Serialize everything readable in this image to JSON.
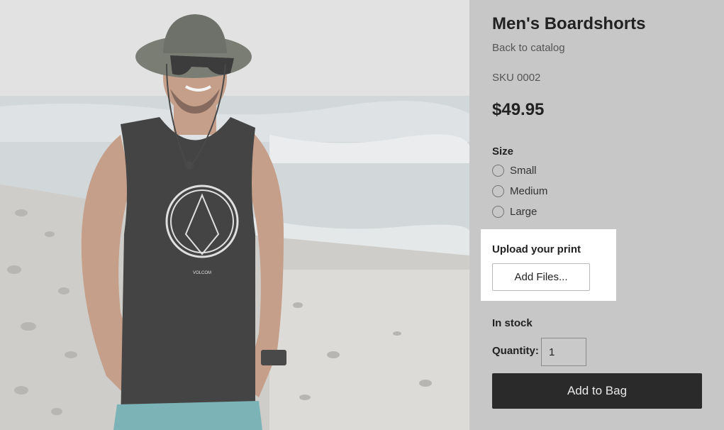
{
  "product": {
    "title": "Men's Boardshorts",
    "back_link": "Back to catalog",
    "sku": "SKU 0002",
    "price": "$49.95"
  },
  "size": {
    "label": "Size",
    "options": [
      "Small",
      "Medium",
      "Large"
    ]
  },
  "upload": {
    "label": "Upload your print",
    "button": "Add Files..."
  },
  "stock_status": "In stock",
  "quantity": {
    "label": "Quantity:",
    "value": "1"
  },
  "add_to_bag": "Add to Bag",
  "photo": {
    "tank_logo_text": "VOLCOM"
  },
  "colors": {
    "page_bg": "#c7c7c7",
    "button_dark": "#2a2a2a",
    "highlight_box": "#ffffff"
  }
}
